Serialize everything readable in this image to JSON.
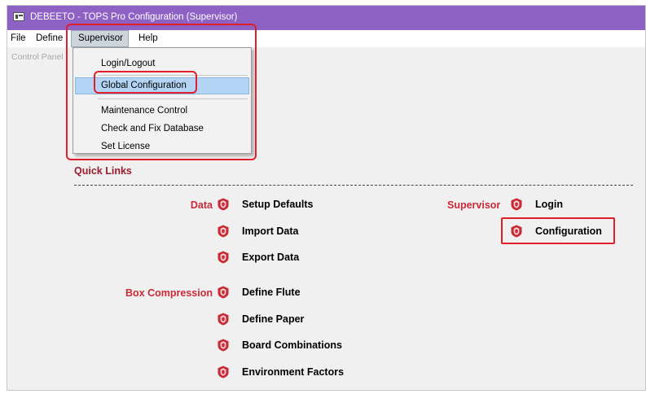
{
  "window": {
    "title": "DEBEETO - TOPS Pro Configuration (Supervisor)"
  },
  "menubar": {
    "items": [
      {
        "label": "File"
      },
      {
        "label": "Define"
      },
      {
        "label": "Supervisor"
      },
      {
        "label": "Help"
      }
    ],
    "open_menu": "Supervisor"
  },
  "panel": {
    "tab_label": "Control Panel"
  },
  "supervisor_menu": {
    "items": [
      {
        "label": "Login/Logout"
      },
      {
        "label": "Global Configuration"
      },
      {
        "label": "Maintenance Control"
      },
      {
        "label": "Check and Fix Database"
      },
      {
        "label": "Set License"
      }
    ],
    "highlighted": "Global Configuration"
  },
  "quick_links": {
    "header": "Quick Links",
    "icon": "red-shield-emblem-icon",
    "groups": [
      {
        "label": "Data",
        "links": [
          {
            "label": "Setup Defaults"
          },
          {
            "label": "Import Data"
          },
          {
            "label": "Export Data"
          }
        ]
      },
      {
        "label": "Box Compression",
        "links": [
          {
            "label": "Define Flute"
          },
          {
            "label": "Define Paper"
          },
          {
            "label": "Board Combinations"
          },
          {
            "label": "Environment Factors"
          }
        ]
      },
      {
        "label": "Supervisor",
        "links": [
          {
            "label": "Login"
          },
          {
            "label": "Configuration"
          }
        ]
      }
    ]
  },
  "colors": {
    "titlebar": "#8e61c4",
    "accent_red": "#c92a36",
    "callout_red": "#e01f2c",
    "menu_highlight": "#b3d4f4"
  }
}
